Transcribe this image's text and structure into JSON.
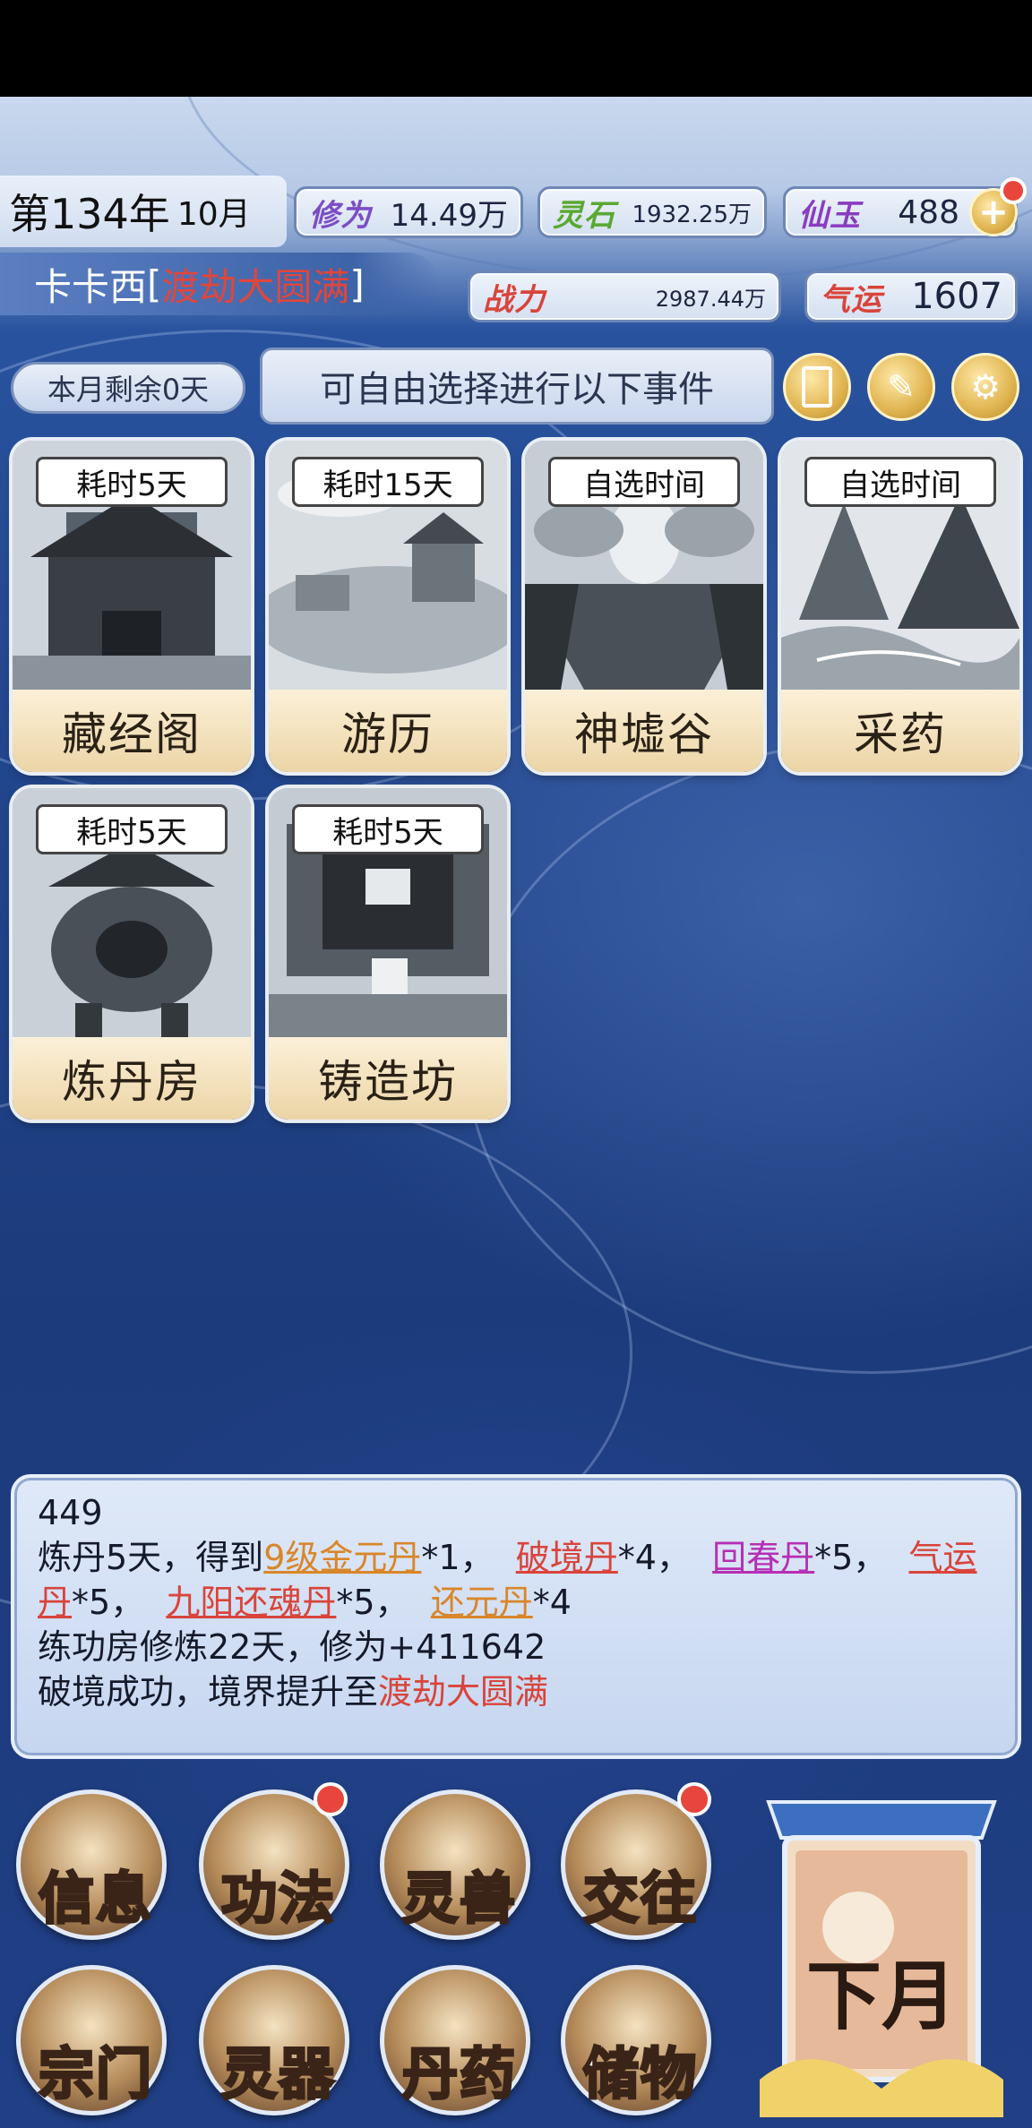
{
  "header": {
    "year_label": "第134年",
    "month_label": "10月",
    "player_name": "卡卡西",
    "realm_bracket_open": "[",
    "realm": "渡劫大圆满",
    "realm_bracket_close": "]"
  },
  "stats": {
    "cultivation": {
      "label": "修为",
      "value": "14.49万"
    },
    "spirit_stone": {
      "label": "灵石",
      "value": "1932.25万"
    },
    "jade": {
      "label": "仙玉",
      "value": "488"
    },
    "power": {
      "label": "战力",
      "value": "2987.44万"
    },
    "luck": {
      "label": "气运",
      "value": "1607"
    }
  },
  "days_left": "本月剩余0天",
  "event_prompt": "可自由选择进行以下事件",
  "events": [
    {
      "tag": "耗时5天",
      "title": "藏经阁"
    },
    {
      "tag": "耗时15天",
      "title": "游历"
    },
    {
      "tag": "自选时间",
      "title": "神墟谷"
    },
    {
      "tag": "自选时间",
      "title": "采药"
    },
    {
      "tag": "耗时5天",
      "title": "炼丹房"
    },
    {
      "tag": "耗时5天",
      "title": "铸造坊"
    }
  ],
  "log": {
    "line0": "449",
    "l1_a": "炼丹5天，得到",
    "l1_item1": "9级金元丹",
    "l1_b": "*1，",
    "l1_item2": "破境丹",
    "l1_c": "*4，",
    "l1_item3": "回春丹",
    "l1_d": "*5，",
    "l1_item4a": "气运",
    "l2_item4b": "丹",
    "l2_a": "*5，",
    "l2_item5": "九阳还魂丹",
    "l2_b": "*5，",
    "l2_item6": "还元丹",
    "l2_c": "*4",
    "line3": "练功房修炼22天，修为+411642",
    "l4_a": "破境成功，境界提升至",
    "l4_realm": "渡劫大圆满"
  },
  "menu": {
    "info": "信息",
    "skills": "功法",
    "beasts": "灵兽",
    "social": "交往",
    "sect": "宗门",
    "artifacts": "灵器",
    "pills": "丹药",
    "storage": "储物",
    "next_month": "下月"
  },
  "colors": {
    "accent_red": "#d9443b",
    "gold_item": "#d9862a",
    "purple_item": "#b62fb5",
    "badge": "#e8453c"
  }
}
